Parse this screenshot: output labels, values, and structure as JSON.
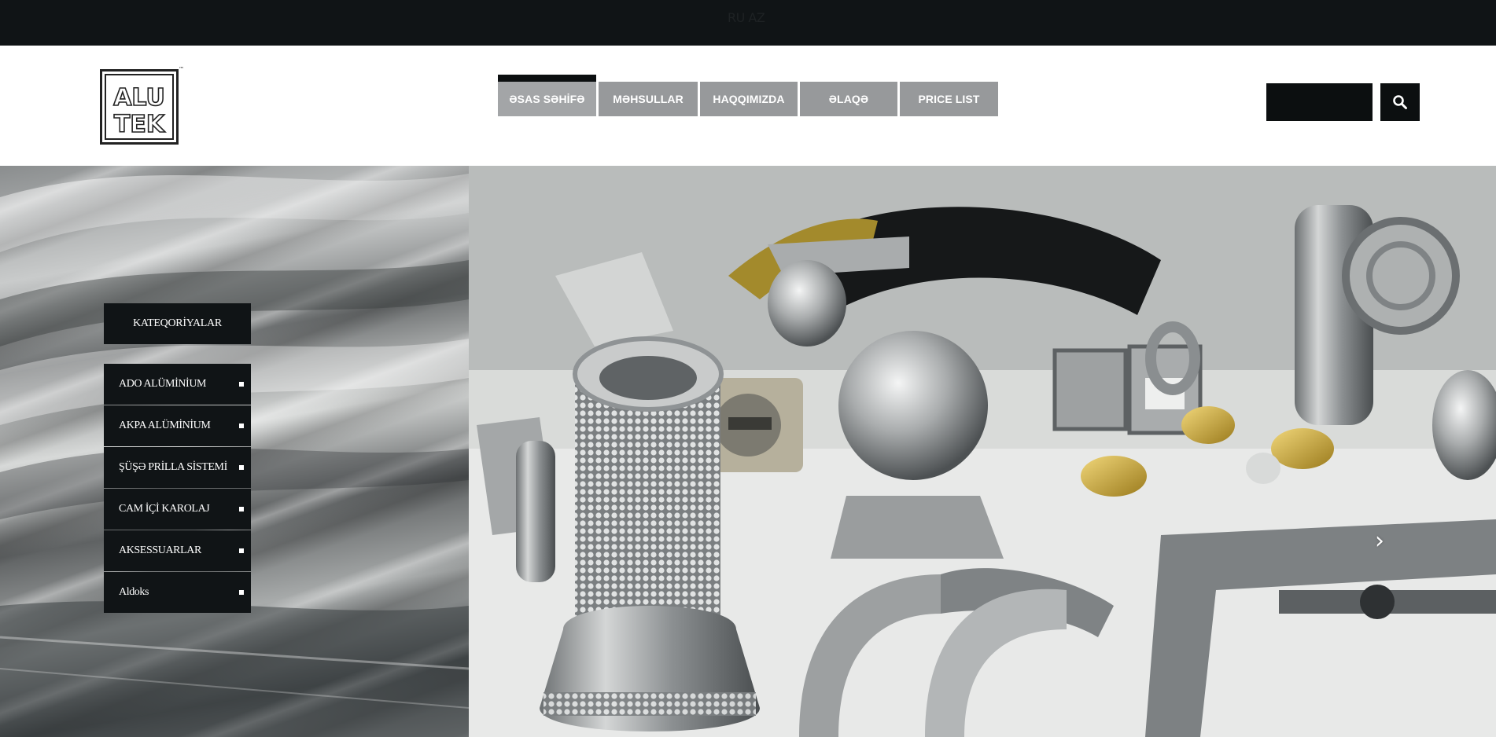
{
  "topbar": {
    "languages": [
      "RU",
      "AZ"
    ]
  },
  "logo": {
    "line1": "ALU",
    "line2": "TEK",
    "tm": "™"
  },
  "nav": {
    "items": [
      {
        "label": "ƏSAS SƏHİFƏ",
        "active": true
      },
      {
        "label": "MƏHSULLAR",
        "active": false
      },
      {
        "label": "HAQQIMIZDA",
        "active": false
      },
      {
        "label": "ƏLAQƏ",
        "active": false
      },
      {
        "label": "PRICE LIST",
        "active": false
      }
    ]
  },
  "search": {
    "value": "",
    "icon": "search-icon"
  },
  "categories": {
    "header": "KATEQORİYALAR",
    "items": [
      {
        "label": "ADO ALÜMİNİUM"
      },
      {
        "label": "AKPA ALÜMİNİUM"
      },
      {
        "label": "ŞÜŞƏ PRİLLA SİSTEMİ"
      },
      {
        "label": "CAM İÇİ KAROLAJ"
      },
      {
        "label": "AKSESSUARLAR"
      },
      {
        "label": "Aldoks"
      }
    ]
  },
  "slider": {
    "next_glyph": "›",
    "image": "aluminium-fittings-photo"
  },
  "colors": {
    "dark": "#101416",
    "nav_gray": "#97999b",
    "white": "#ffffff"
  }
}
